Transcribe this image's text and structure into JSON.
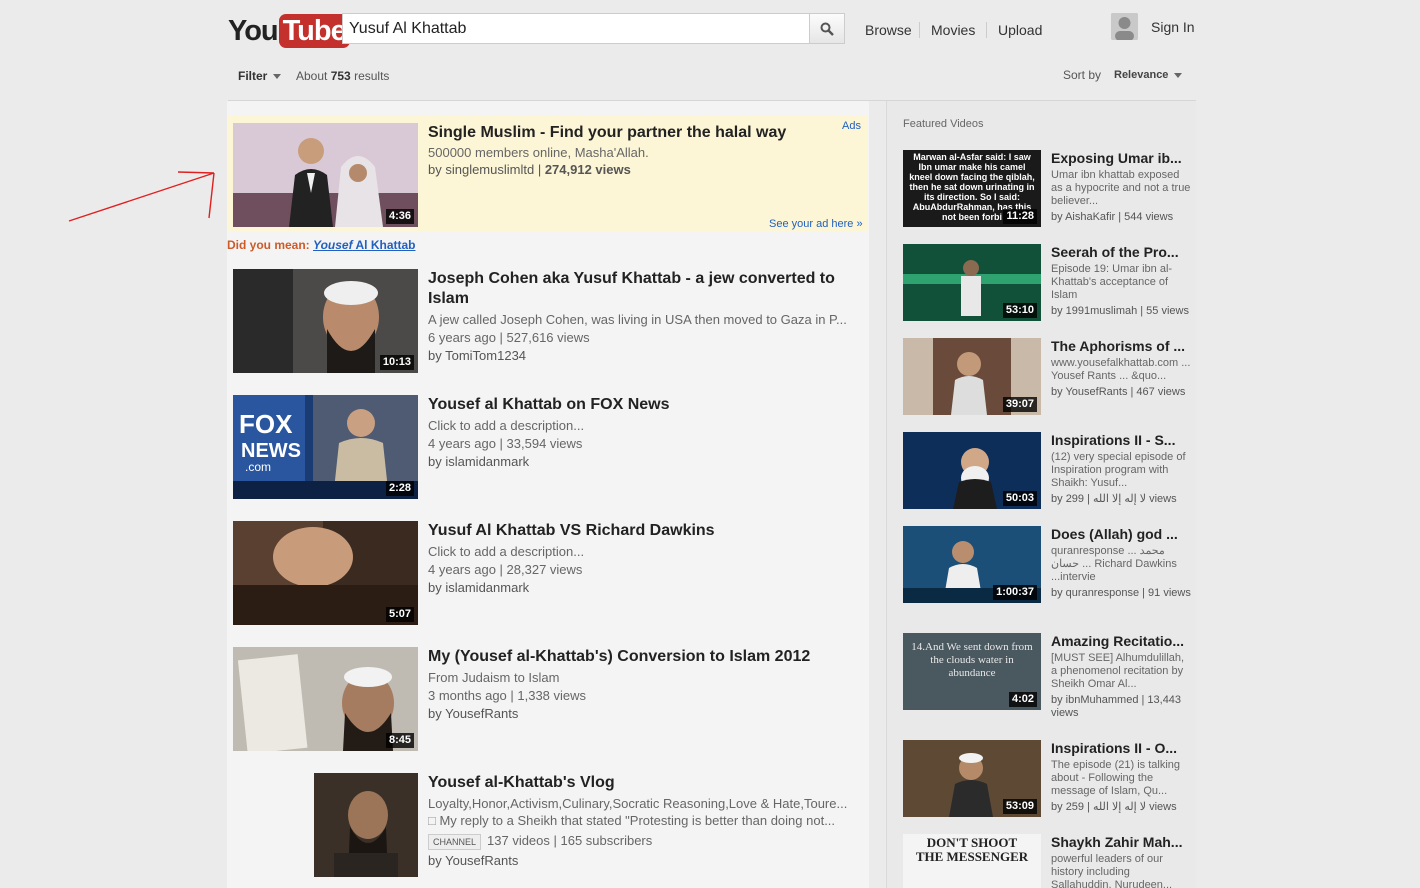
{
  "header": {
    "logo_you": "You",
    "logo_tube": "Tube",
    "search_value": "Yusuf Al Khattab",
    "nav": [
      "Browse",
      "Movies",
      "Upload"
    ],
    "sign_in": "Sign In"
  },
  "filters": {
    "filter_label": "Filter",
    "results_prefix": "About",
    "results_count": "753",
    "results_suffix": "results",
    "sort_by": "Sort by",
    "relevance": "Relevance"
  },
  "ad": {
    "label": "Ads",
    "title": "Single Muslim - Find your partner the halal way",
    "desc": "500000 members online, Masha'Allah.",
    "by": "by singlemuslimltd",
    "views": "274,912 views",
    "duration": "4:36",
    "see_ad": "See your ad here »"
  },
  "did_you_mean": {
    "label": "Did you mean:",
    "corrected_part": "Yousef",
    "rest": "Al Khattab"
  },
  "results": [
    {
      "title": "Joseph Cohen aka Yusuf Khattab - a jew converted to Islam",
      "desc": "A jew called Joseph Cohen, was living in USA then moved to Gaza in P...",
      "meta": "6 years ago | 527,616 views",
      "by": "by TomiTom1234",
      "duration": "10:13"
    },
    {
      "title": "Yousef al Khattab on FOX News",
      "desc": "Click to add a description...",
      "meta": "4 years ago | 33,594 views",
      "by": "by islamidanmark",
      "duration": "2:28"
    },
    {
      "title": "Yusuf Al Khattab VS Richard Dawkins",
      "desc": "Click to add a description...",
      "meta": "4 years ago | 28,327 views",
      "by": "by islamidanmark",
      "duration": "5:07"
    },
    {
      "title": "My (Yousef al-Khattab's) Conversion to Islam 2012",
      "desc": "From Judaism to Islam",
      "meta": "3 months ago | 1,338 views",
      "by": "by YousefRants",
      "duration": "8:45"
    }
  ],
  "channel": {
    "title": "Yousef al-Khattab's Vlog",
    "desc1": "Loyalty,Honor,Activism,Culinary,Socratic Reasoning,Love & Hate,Toure...",
    "desc2": "My reply to a Sheikh that stated \"Protesting is better than doing not...",
    "badge": "CHANNEL",
    "stats": "137 videos | 165 subscribers",
    "by": "by YousefRants"
  },
  "sidebar": {
    "title": "Featured Videos",
    "items": [
      {
        "title": "Exposing Umar ib...",
        "desc": "Umar ibn khattab exposed as a hypocrite and not a true believer...",
        "by": "by AishaKafir | 544 views",
        "duration": "11:28",
        "thumb_text": "Marwan al-Asfar said: I saw Ibn umar make his camel kneel down facing the qiblah, then he sat down urinating in its direction. So I said: AbuAbdurRahman, has this not been forbi"
      },
      {
        "title": "Seerah of the Pro...",
        "desc": "Episode 19: Umar ibn al-Khattab's acceptance of Islam",
        "by": "by 1991muslimah | 55 views",
        "duration": "53:10"
      },
      {
        "title": "The Aphorisms of ...",
        "desc": "www.yousefalkhattab.com ... Yousef Rants ... &quo...",
        "by": "by YousefRants | 467 views",
        "duration": "39:07"
      },
      {
        "title": "Inspirations II - S...",
        "desc": "(12) very special episode of Inspiration program with Shaikh: Yusuf...",
        "by": "by لا إله إلا الله | 299 views",
        "duration": "50:03"
      },
      {
        "title": "Does (Allah) god ...",
        "desc": "quranresponse ... محمد حسان ... Richard Dawkins ...intervie",
        "by": "by quranresponse | 91 views",
        "duration": "1:00:37"
      },
      {
        "title": "Amazing Recitatio...",
        "desc": "[MUST SEE] Alhumdulillah, a phenomenol recitation by Sheikh Omar Al...",
        "by": "by ibnMuhammed | 13,443 views",
        "duration": "4:02",
        "thumb_text": "14.And We sent down from the clouds water in abundance"
      },
      {
        "title": "Inspirations II - O...",
        "desc": "The episode (21) is talking about - Following the message of Islam, Qu...",
        "by": "by لا إله إلا الله | 259 views",
        "duration": "53:09"
      },
      {
        "title": "Shaykh Zahir Mah...",
        "desc": "powerful leaders of our history including Sallahuddin, Nurudeen...",
        "by": "",
        "duration": "",
        "thumb_text": "DON'T SHOOT THE MESSENGER"
      }
    ]
  },
  "colors": {
    "brand": "#c4302b",
    "link": "#2260c0",
    "ad_bg": "#fcf6d6",
    "annotation": "#e02020"
  }
}
